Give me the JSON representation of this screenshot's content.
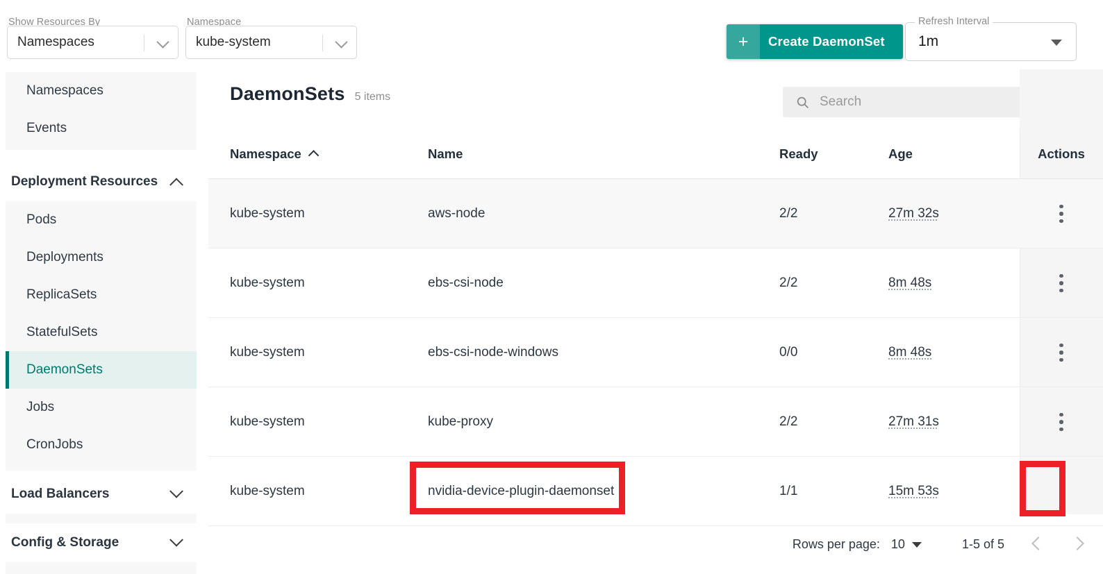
{
  "toolbar": {
    "show_resources_by": {
      "label": "Show Resources By",
      "value": "Namespaces"
    },
    "namespace": {
      "label": "Namespace",
      "value": "kube-system"
    },
    "create_button": {
      "plus": "+",
      "label": "Create DaemonSet"
    },
    "refresh_interval": {
      "label": "Refresh Interval",
      "value": "1m"
    }
  },
  "sidebar": {
    "top_items": [
      {
        "label": "Namespaces"
      },
      {
        "label": "Events"
      }
    ],
    "sections": [
      {
        "label": "Deployment Resources",
        "expanded": true,
        "items": [
          {
            "label": "Pods",
            "active": false
          },
          {
            "label": "Deployments",
            "active": false
          },
          {
            "label": "ReplicaSets",
            "active": false
          },
          {
            "label": "StatefulSets",
            "active": false
          },
          {
            "label": "DaemonSets",
            "active": true
          },
          {
            "label": "Jobs",
            "active": false
          },
          {
            "label": "CronJobs",
            "active": false
          }
        ]
      },
      {
        "label": "Load Balancers",
        "expanded": false,
        "items": []
      },
      {
        "label": "Config & Storage",
        "expanded": false,
        "items": []
      }
    ]
  },
  "main": {
    "title": "DaemonSets",
    "item_count": "5 items",
    "search": {
      "placeholder": "Search",
      "value": ""
    },
    "columns": [
      {
        "key": "namespace",
        "label": "Namespace",
        "sorted": "asc"
      },
      {
        "key": "name",
        "label": "Name",
        "sorted": ""
      },
      {
        "key": "ready",
        "label": "Ready",
        "sorted": ""
      },
      {
        "key": "age",
        "label": "Age",
        "sorted": ""
      },
      {
        "key": "actions",
        "label": "Actions",
        "sorted": ""
      }
    ],
    "rows": [
      {
        "namespace": "kube-system",
        "name": "aws-node",
        "ready": "2/2",
        "age": "27m 32s"
      },
      {
        "namespace": "kube-system",
        "name": "ebs-csi-node",
        "ready": "2/2",
        "age": "8m 48s"
      },
      {
        "namespace": "kube-system",
        "name": "ebs-csi-node-windows",
        "ready": "0/0",
        "age": "8m 48s"
      },
      {
        "namespace": "kube-system",
        "name": "kube-proxy",
        "ready": "2/2",
        "age": "27m 31s"
      },
      {
        "namespace": "kube-system",
        "name": "nvidia-device-plugin-daemonset",
        "ready": "1/1",
        "age": "15m 53s"
      }
    ],
    "pagination": {
      "rows_per_page_label": "Rows per page:",
      "rows_per_page_value": "10",
      "range": "1-5 of 5",
      "prev": "‹",
      "next": "›"
    }
  },
  "colors": {
    "accent_teal": "#00968b",
    "accent_teal_light": "#35a79c",
    "active_nav": "#00796b",
    "annotation_red": "#ee2027"
  }
}
